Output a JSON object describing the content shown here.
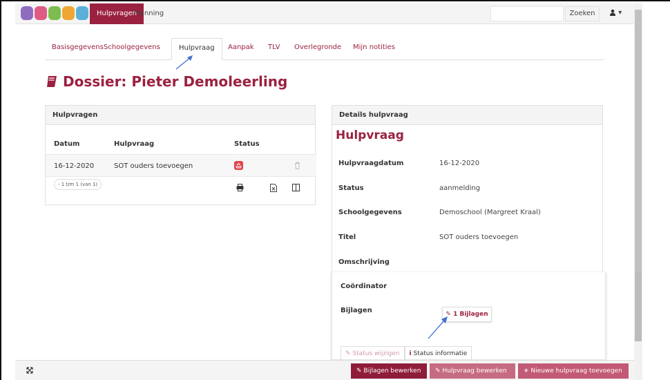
{
  "nav": {
    "tabs": [
      {
        "label": "Hulpvragen"
      },
      {
        "label": "Planning"
      }
    ],
    "search_button": "Zoeken",
    "user_caret": "▾",
    "brand_color": "#9b2140"
  },
  "tabs": [
    {
      "label": "Basisgegevens"
    },
    {
      "label": "Schoolgegevens"
    },
    {
      "label": "Hulpvraag"
    },
    {
      "label": "Aanpak"
    },
    {
      "label": "TLV"
    },
    {
      "label": "Overlegronde"
    },
    {
      "label": "Mijn notities"
    }
  ],
  "page_title": "Dossier: Pieter Demoleerling",
  "hulpvragen": {
    "heading": "Hulpvragen",
    "columns": [
      "Datum",
      "Hulpvraag",
      "Status"
    ],
    "rows": [
      {
        "datum": "16-12-2020",
        "hulpvraag": "SOT ouders toevoegen"
      }
    ],
    "pager": "- 1 t/m 1 (van 1)"
  },
  "details": {
    "heading": "Details hulpvraag",
    "title": "Hulpvraag",
    "fields": [
      {
        "label": "Hulpvraagdatum",
        "value": "16-12-2020"
      },
      {
        "label": "Status",
        "value": "aanmelding"
      },
      {
        "label": "Schoolgegevens",
        "value": "Demoschool (Margreet Kraal)"
      },
      {
        "label": "Titel",
        "value": "SOT ouders toevoegen"
      },
      {
        "label": "Omschrijving",
        "value": ""
      },
      {
        "label": "Coördinator",
        "value": ""
      },
      {
        "label": "Bijlagen",
        "value": ""
      }
    ],
    "attach_button": "1 Bijlagen",
    "status_change": "Status wijzigen",
    "status_info": "Status informatie"
  },
  "footer": {
    "edit_attachments": "Bijlagen bewerken",
    "edit_request": "Hulpvraag bewerken",
    "new_request": "Nieuwe hulpvraag toevoegen"
  }
}
